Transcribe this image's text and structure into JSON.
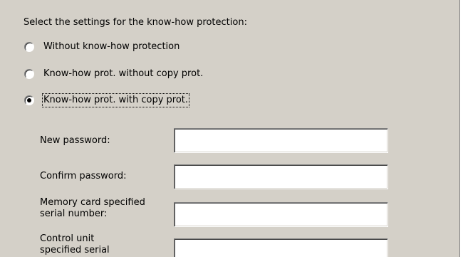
{
  "heading": "Select the settings for the know-how protection:",
  "radios": [
    {
      "label": "Without know-how protection",
      "checked": false
    },
    {
      "label": "Know-how prot. without copy prot.",
      "checked": false
    },
    {
      "label": "Know-how prot. with copy prot.",
      "checked": true
    }
  ],
  "fields": [
    {
      "label": "New password:",
      "value": ""
    },
    {
      "label": "Confirm password:",
      "value": ""
    },
    {
      "label": "Memory card specified serial number:",
      "value": ""
    },
    {
      "label": "Control unit specified serial",
      "value": ""
    }
  ],
  "colors": {
    "panel_background": "#d4d0c8",
    "input_background": "#ffffff"
  }
}
